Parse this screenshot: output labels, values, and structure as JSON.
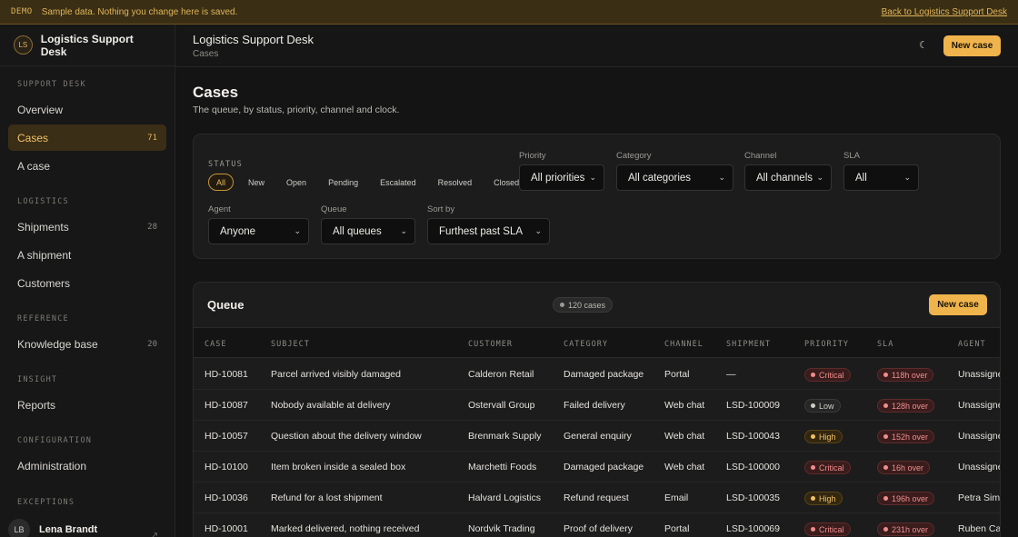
{
  "banner": {
    "tag": "DEMO",
    "text": "Sample data. Nothing you change here is saved.",
    "link": "Back to Logistics Support Desk"
  },
  "brand": {
    "initials": "LS",
    "name": "Logistics Support Desk"
  },
  "nav": {
    "sections": [
      "SUPPORT DESK",
      "LOGISTICS",
      "REFERENCE",
      "INSIGHT",
      "CONFIGURATION",
      "EXCEPTIONS"
    ],
    "items": [
      {
        "label": "Overview",
        "count": ""
      },
      {
        "label": "Cases",
        "count": "71"
      },
      {
        "label": "A case",
        "count": ""
      },
      {
        "label": "Shipments",
        "count": "28"
      },
      {
        "label": "A shipment",
        "count": ""
      },
      {
        "label": "Customers",
        "count": ""
      },
      {
        "label": "Knowledge base",
        "count": "20"
      },
      {
        "label": "Reports",
        "count": ""
      },
      {
        "label": "Administration",
        "count": ""
      }
    ]
  },
  "user": {
    "initials": "LB",
    "name": "Lena Brandt"
  },
  "topbar": {
    "title": "Logistics Support Desk",
    "crumb": "Cases",
    "new_case": "New case"
  },
  "page": {
    "title": "Cases",
    "subtitle": "The queue, by status, priority, channel and clock."
  },
  "filters": {
    "status_label": "STATUS",
    "status_chips": [
      "All",
      "New",
      "Open",
      "Pending",
      "Escalated",
      "Resolved",
      "Closed"
    ],
    "priority_label": "Priority",
    "priority_value": "All priorities",
    "category_label": "Category",
    "category_value": "All categories",
    "channel_label": "Channel",
    "channel_value": "All channels",
    "sla_label": "SLA",
    "sla_value": "All",
    "agent_label": "Agent",
    "agent_value": "Anyone",
    "queue_label": "Queue",
    "queue_value": "All queues",
    "sort_label": "Sort by",
    "sort_value": "Furthest past SLA"
  },
  "queue": {
    "title": "Queue",
    "count": "120 cases",
    "new_case": "New case",
    "columns": [
      "CASE",
      "SUBJECT",
      "CUSTOMER",
      "CATEGORY",
      "CHANNEL",
      "SHIPMENT",
      "PRIORITY",
      "SLA",
      "AGENT"
    ],
    "rows": [
      {
        "id": "HD-10081",
        "subject": "Parcel arrived visibly damaged",
        "customer": "Calderon Retail",
        "category": "Damaged package",
        "channel": "Portal",
        "shipment": "—",
        "priority": "Critical",
        "sla": "118h over",
        "agent": "Unassigned"
      },
      {
        "id": "HD-10087",
        "subject": "Nobody available at delivery",
        "customer": "Ostervall Group",
        "category": "Failed delivery",
        "channel": "Web chat",
        "shipment": "LSD-100009",
        "priority": "Low",
        "sla": "128h over",
        "agent": "Unassigned"
      },
      {
        "id": "HD-10057",
        "subject": "Question about the delivery window",
        "customer": "Brenmark Supply",
        "category": "General enquiry",
        "channel": "Web chat",
        "shipment": "LSD-100043",
        "priority": "High",
        "sla": "152h over",
        "agent": "Unassigned"
      },
      {
        "id": "HD-10100",
        "subject": "Item broken inside a sealed box",
        "customer": "Marchetti Foods",
        "category": "Damaged package",
        "channel": "Web chat",
        "shipment": "LSD-100000",
        "priority": "Critical",
        "sla": "16h over",
        "agent": "Unassigned"
      },
      {
        "id": "HD-10036",
        "subject": "Refund for a lost shipment",
        "customer": "Halvard Logistics",
        "category": "Refund request",
        "channel": "Email",
        "shipment": "LSD-100035",
        "priority": "High",
        "sla": "196h over",
        "agent": "Petra Simić"
      },
      {
        "id": "HD-10001",
        "subject": "Marked delivered, nothing received",
        "customer": "Nordvik Trading",
        "category": "Proof of delivery",
        "channel": "Portal",
        "shipment": "LSD-100069",
        "priority": "Critical",
        "sla": "231h over",
        "agent": "Ruben Castro"
      }
    ]
  },
  "colors": {
    "accent": "#f0b44c",
    "critical": "#f08d8d",
    "high": "#f0c067",
    "low": "#cfcdc8"
  }
}
